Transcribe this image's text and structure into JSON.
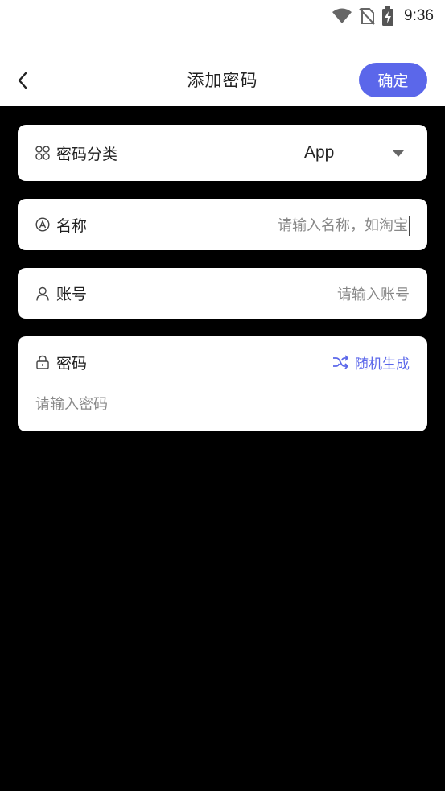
{
  "status": {
    "time": "9:36"
  },
  "header": {
    "title": "添加密码",
    "confirm_label": "确定"
  },
  "form": {
    "category": {
      "label": "密码分类",
      "value": "App"
    },
    "name": {
      "label": "名称",
      "placeholder": "请输入名称，如淘宝"
    },
    "account": {
      "label": "账号",
      "placeholder": "请输入账号"
    },
    "password": {
      "label": "密码",
      "random_label": "随机生成",
      "placeholder": "请输入密码"
    }
  },
  "colors": {
    "accent": "#5b67ea",
    "background": "#000000",
    "card": "#ffffff"
  }
}
